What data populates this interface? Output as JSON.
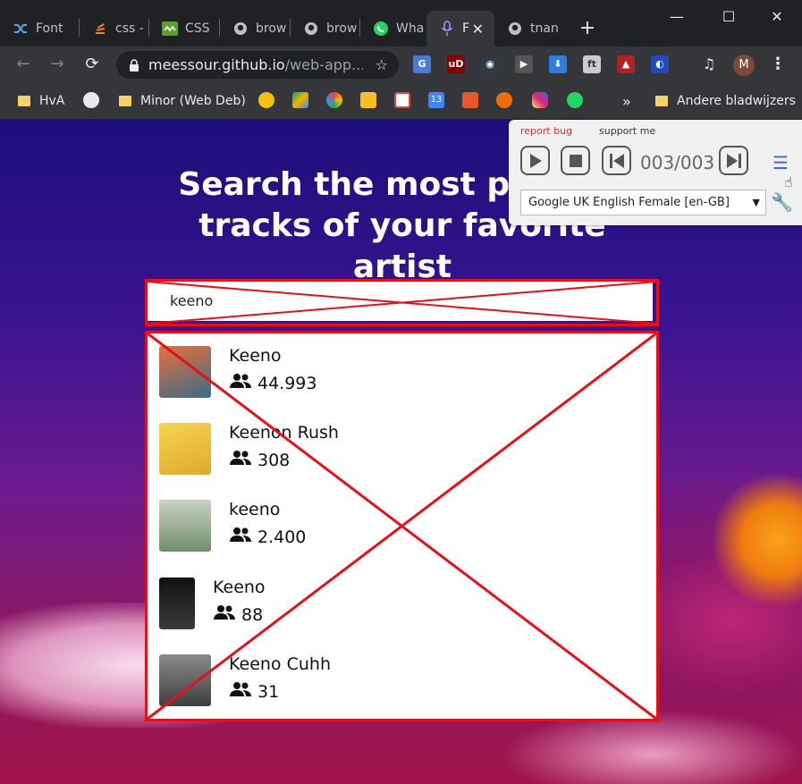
{
  "tabs": [
    {
      "title": "Font",
      "icon": "font-tab-icon"
    },
    {
      "title": "css -",
      "icon": "stackoverflow-icon"
    },
    {
      "title": "CSS",
      "icon": "css-tab-icon"
    },
    {
      "title": "brow",
      "icon": "github-icon"
    },
    {
      "title": "brow",
      "icon": "github-icon"
    },
    {
      "title": "Wha",
      "icon": "whatsapp-icon"
    },
    {
      "title": "F",
      "icon": "microphone-icon",
      "active": true
    },
    {
      "title": "tnan",
      "icon": "github-icon"
    }
  ],
  "omnibox": {
    "host": "meessour.github.io",
    "path": "/web-app..."
  },
  "avatar_letter": "M",
  "bookmarks": {
    "hva": "HvA",
    "minor": "Minor (Web Deb)",
    "other": "Andere bladwijzers",
    "more": "»"
  },
  "page": {
    "heading": "Search the most popular tracks of your favorite artist",
    "search_value": "keeno",
    "artists": [
      {
        "name": "Keeno",
        "fans": "44.993",
        "thumb": "#d2563a"
      },
      {
        "name": "Keenon Rush",
        "fans": "308",
        "thumb": "#f2c84b"
      },
      {
        "name": "keeno",
        "fans": "2.400",
        "thumb": "#8fa88a"
      },
      {
        "name": "Keeno",
        "fans": "88",
        "thumb": "#2b2b2b"
      },
      {
        "name": "Keeno Cuhh",
        "fans": "31",
        "thumb": "#6b6b6b"
      }
    ]
  },
  "tts": {
    "report_bug": "report bug",
    "support": "support me",
    "counter": "003/003",
    "voice": "Google UK English Female [en-GB]"
  },
  "colors": {
    "accent_red": "#e5101a",
    "tts_blue": "#3a6fd8"
  }
}
